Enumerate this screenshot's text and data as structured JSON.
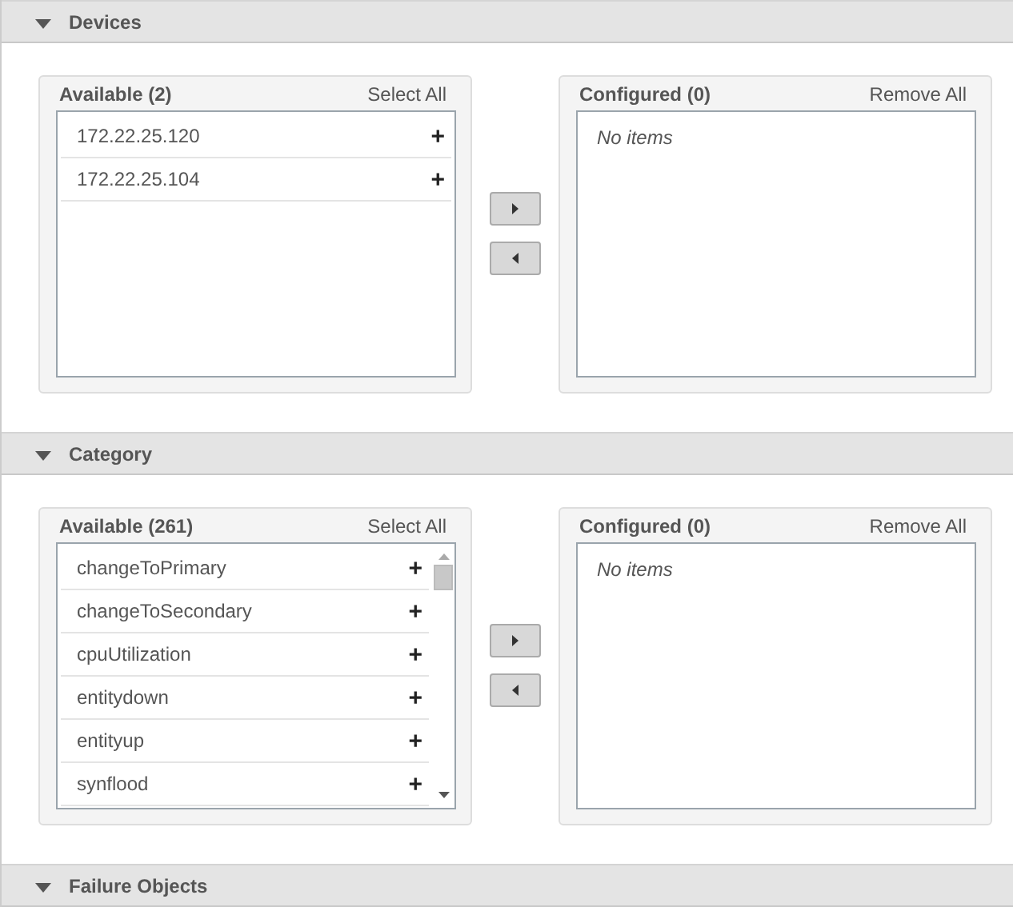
{
  "sections": [
    {
      "title": "Devices",
      "available": {
        "title": "Available (2)",
        "action": "Select All",
        "scrollbar": false,
        "items": [
          {
            "label": "172.22.25.120",
            "action": "+"
          },
          {
            "label": "172.22.25.104",
            "action": "+"
          }
        ]
      },
      "configured": {
        "title": "Configured (0)",
        "action": "Remove All",
        "empty_text": "No items"
      }
    },
    {
      "title": "Category",
      "available": {
        "title": "Available (261)",
        "action": "Select All",
        "scrollbar": true,
        "items": [
          {
            "label": "changeToPrimary",
            "action": "+"
          },
          {
            "label": "changeToSecondary",
            "action": "+"
          },
          {
            "label": "cpuUtilization",
            "action": "+"
          },
          {
            "label": "entitydown",
            "action": "+"
          },
          {
            "label": "entityup",
            "action": "+"
          },
          {
            "label": "synflood",
            "action": "+"
          }
        ]
      },
      "configured": {
        "title": "Configured (0)",
        "action": "Remove All",
        "empty_text": "No items"
      }
    },
    {
      "title": "Failure Objects"
    }
  ]
}
